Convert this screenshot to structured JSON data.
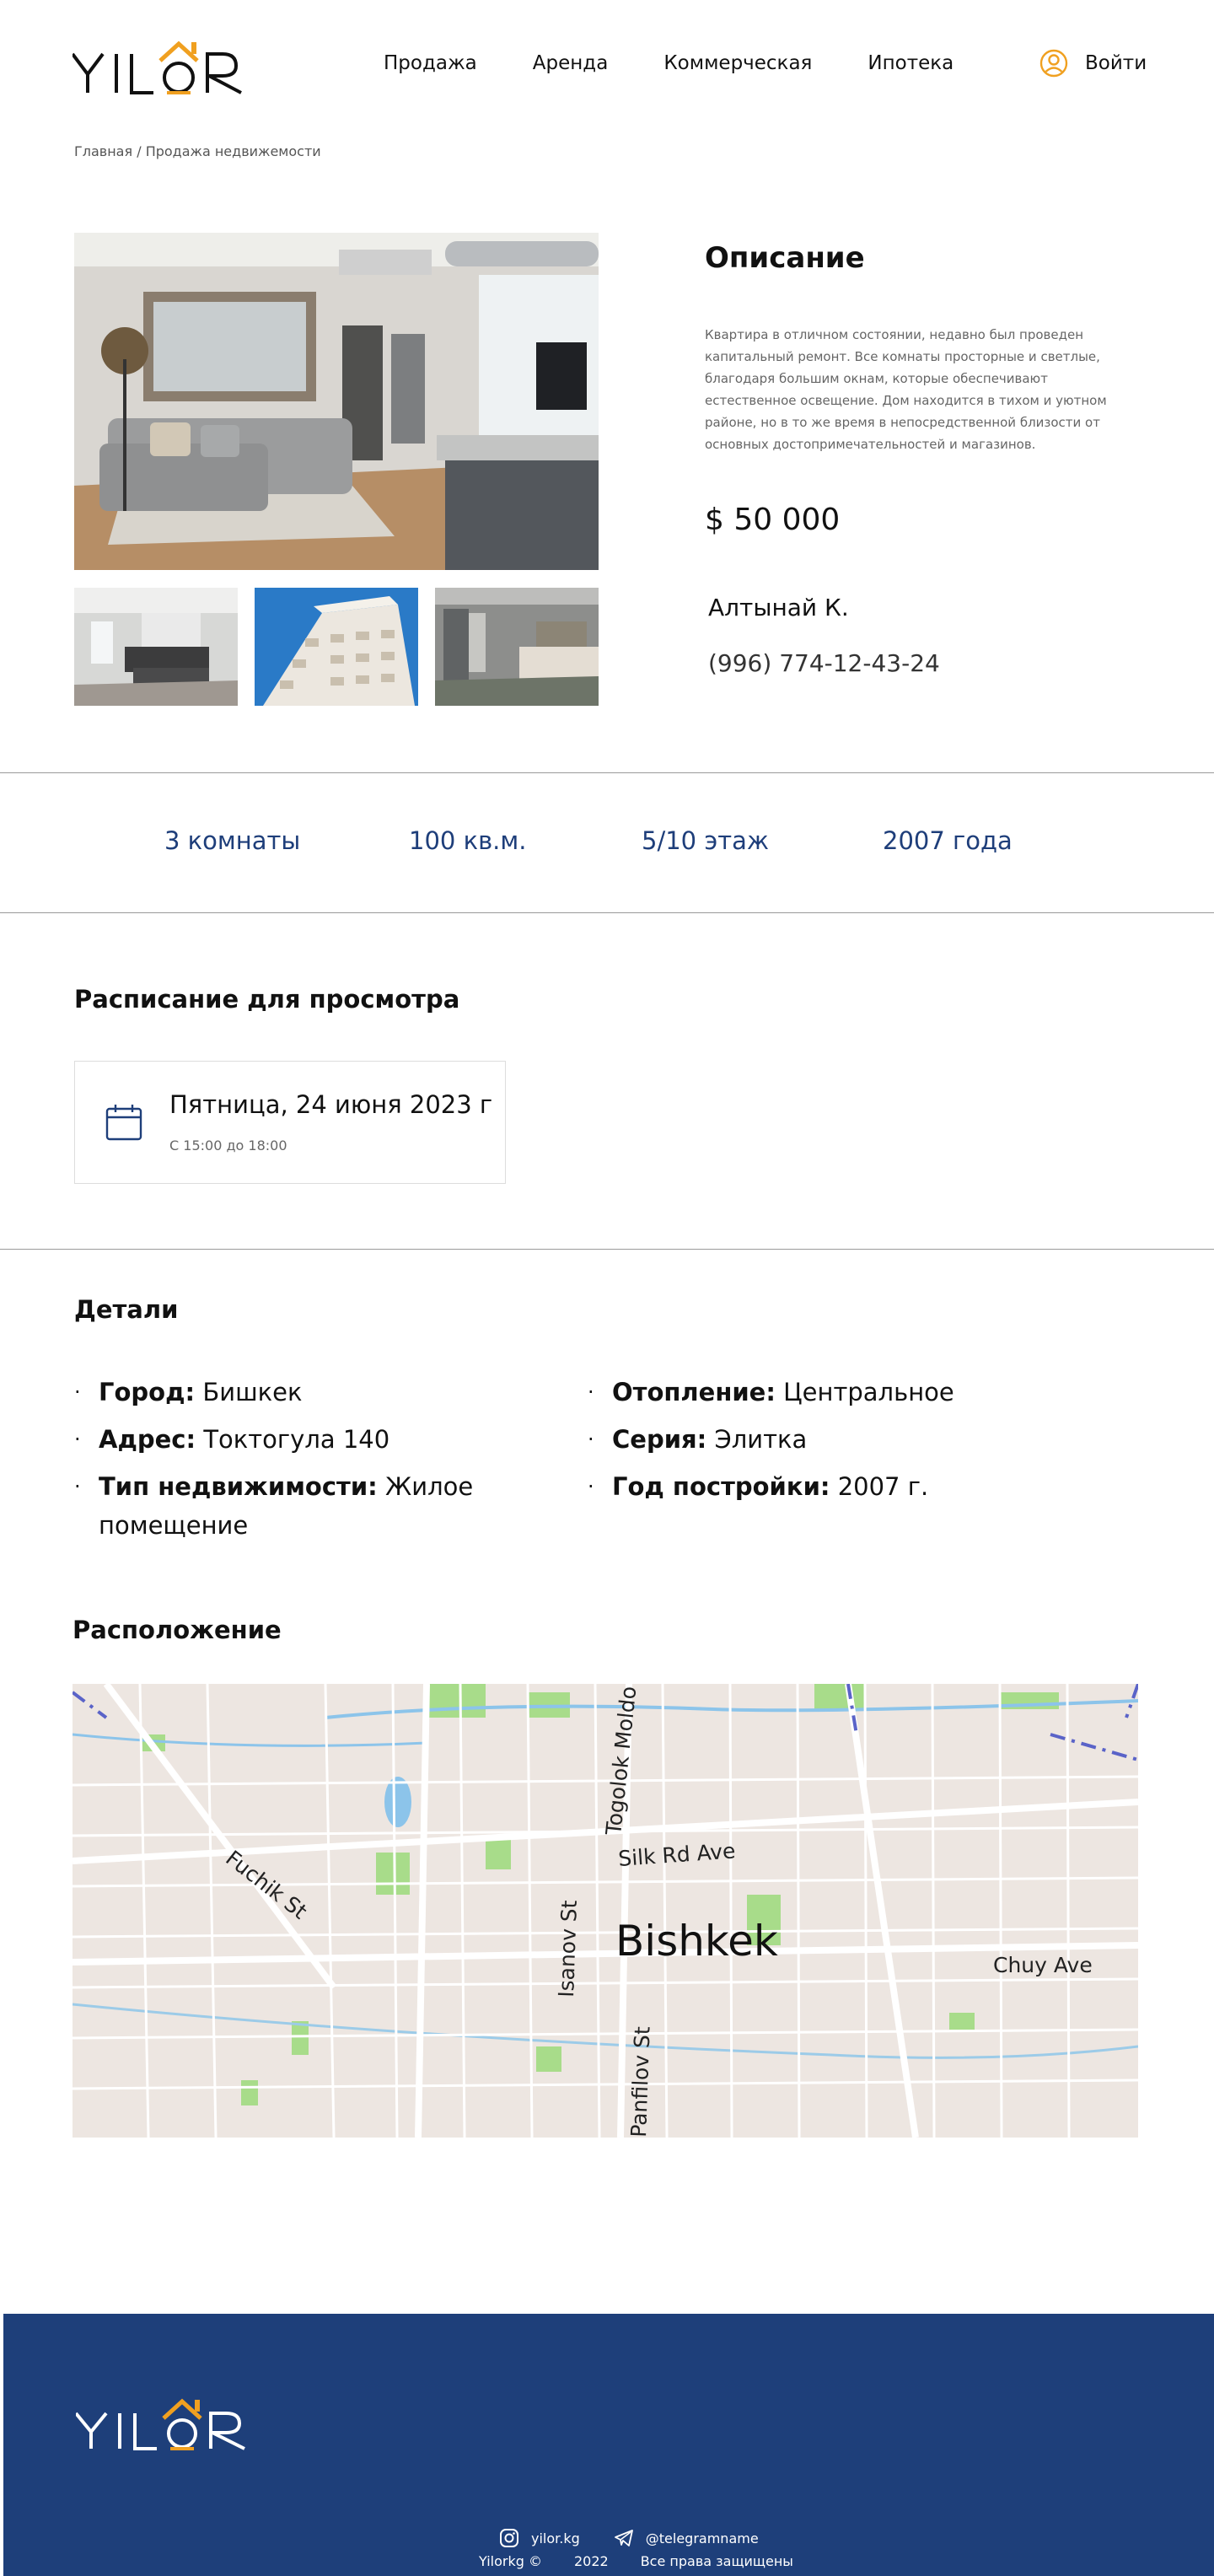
{
  "header": {
    "logo_text": "YILOR",
    "nav": [
      "Продажа",
      "Аренда",
      "Коммерческая",
      "Ипотека"
    ],
    "login_label": "Войти"
  },
  "breadcrumb": {
    "home": "Главная",
    "separator": "/",
    "current": "Продажа недвижемости"
  },
  "listing": {
    "description_title": "Описание",
    "description_text": "Квартира в отличном состоянии, недавно был проведен капитальный ремонт. Все комнаты просторные и светлые, благодаря большим окнам, которые обеспечивают естественное освещение. Дом находится в тихом и уютном районе, но в то же время в непосредственной близости от основных достопримечательностей и магазинов.",
    "price": "$ 50 000",
    "agent_name": "Алтынай К.",
    "agent_phone": "(996) 774-12-43-24"
  },
  "facts": [
    "3 комнаты",
    "100 кв.м.",
    "5/10 этаж",
    "2007 года"
  ],
  "schedule": {
    "title": "Расписание для просмотра",
    "date": "Пятница, 24 июня 2023 г",
    "time": "С 15:00 до 18:00"
  },
  "details": {
    "title": "Детали",
    "left": [
      {
        "label": "Город:",
        "value": "Бишкек"
      },
      {
        "label": "Адрес:",
        "value": "Токтогула 140"
      },
      {
        "label": "Тип недвижимости:",
        "value": "Жилое помещение"
      }
    ],
    "right": [
      {
        "label": "Отопление:",
        "value": "Центральное"
      },
      {
        "label": "Серия:",
        "value": "Элитка"
      },
      {
        "label": "Год постройки:",
        "value": "2007 г."
      }
    ]
  },
  "location": {
    "title": "Расположение",
    "map_city": "Bishkek",
    "map_streets": [
      "Fuchik St",
      "Togolok Moldo St",
      "Silk Rd Ave",
      "Isanov St",
      "Panfilov St",
      "Chuy Ave"
    ]
  },
  "footer": {
    "logo_text": "YILOR",
    "site": "yilor.kg",
    "telegram": "@telegramname",
    "brand": "Yilorkg",
    "copyright_symbol": "©",
    "year": "2022",
    "rights": "Все права защищены"
  },
  "colors": {
    "accent_blue": "#1e3f7a",
    "accent_orange": "#f0a020",
    "fact_blue": "#1e3e7a"
  }
}
